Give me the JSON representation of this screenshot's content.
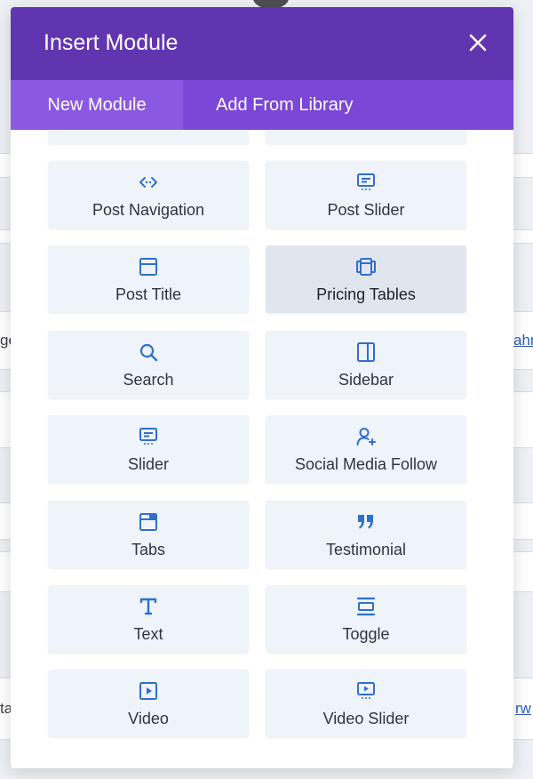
{
  "background": {
    "left_snippets": [
      "ge",
      "ta"
    ],
    "right_links": [
      "ahn",
      "rw"
    ]
  },
  "modal": {
    "title": "Insert Module",
    "close_label": "×",
    "tabs": [
      {
        "label": "New Module",
        "active": true
      },
      {
        "label": "Add From Library",
        "active": false
      }
    ],
    "modules": [
      {
        "label": "Post Navigation",
        "icon": "post-navigation-icon"
      },
      {
        "label": "Post Slider",
        "icon": "post-slider-icon"
      },
      {
        "label": "Post Title",
        "icon": "post-title-icon"
      },
      {
        "label": "Pricing Tables",
        "icon": "pricing-tables-icon",
        "hovered": true
      },
      {
        "label": "Search",
        "icon": "search-icon"
      },
      {
        "label": "Sidebar",
        "icon": "sidebar-icon"
      },
      {
        "label": "Slider",
        "icon": "slider-icon"
      },
      {
        "label": "Social Media Follow",
        "icon": "social-follow-icon"
      },
      {
        "label": "Tabs",
        "icon": "tabs-icon"
      },
      {
        "label": "Testimonial",
        "icon": "quote-icon"
      },
      {
        "label": "Text",
        "icon": "text-icon"
      },
      {
        "label": "Toggle",
        "icon": "toggle-icon"
      },
      {
        "label": "Video",
        "icon": "video-icon"
      },
      {
        "label": "Video Slider",
        "icon": "video-slider-icon"
      }
    ]
  },
  "colors": {
    "header": "#6235b0",
    "tab_bar": "#7a47d6",
    "tab_active": "#8b58e2",
    "icon": "#2e6fd0",
    "tile": "#eff3fa",
    "tile_hover": "#e1e6ee"
  }
}
